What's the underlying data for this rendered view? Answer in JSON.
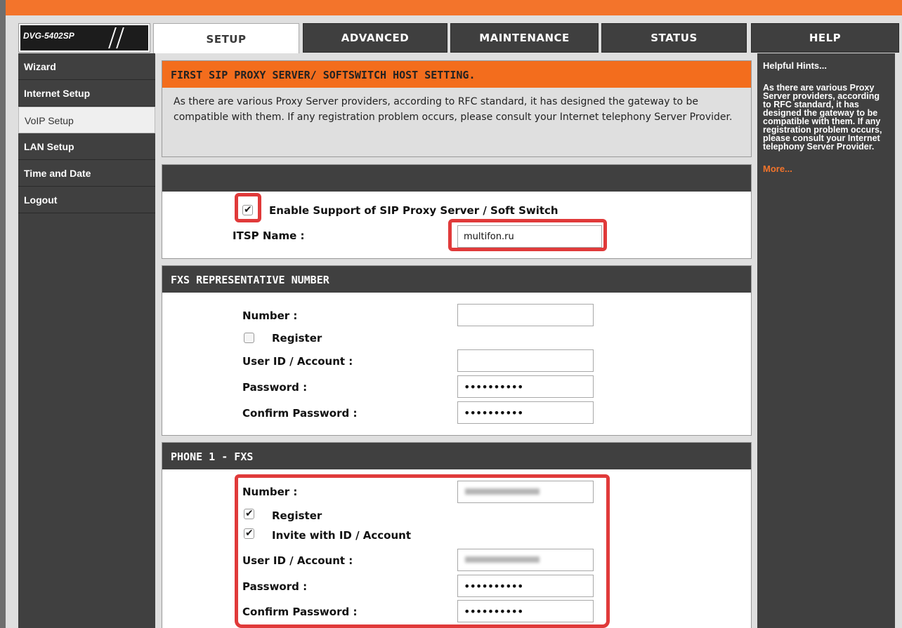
{
  "logo": {
    "text": "DVG-5402SP"
  },
  "tabs": [
    {
      "label": "SETUP"
    },
    {
      "label": "ADVANCED"
    },
    {
      "label": "MAINTENANCE"
    },
    {
      "label": "STATUS"
    },
    {
      "label": "HELP"
    }
  ],
  "nav": [
    {
      "label": "Wizard"
    },
    {
      "label": "Internet Setup"
    },
    {
      "label": "VoIP Setup"
    },
    {
      "label": "LAN Setup"
    },
    {
      "label": "Time and Date"
    },
    {
      "label": "Logout"
    }
  ],
  "help": {
    "title": "Helpful Hints...",
    "body": "As there are various Proxy Server providers, according to RFC standard, it has designed the gateway to be compatible with them. If any registration problem occurs, please consult your Internet telephony Server Provider.",
    "more": "More..."
  },
  "intro": {
    "heading": "FIRST SIP PROXY SERVER/ SOFTSWITCH HOST SETTING.",
    "body": "As there are various Proxy Server providers, according to RFC standard, it has designed the gateway to be compatible with them. If any registration problem occurs, please consult your Internet telephony Server Provider."
  },
  "proxy": {
    "enable_label": "Enable Support of SIP Proxy Server / Soft Switch",
    "enable_checked": true,
    "itsp_label": "ITSP Name :",
    "itsp_value": "multifon.ru"
  },
  "fxs_rep": {
    "heading": "FXS REPRESENTATIVE NUMBER",
    "number_label": "Number :",
    "number_value": "",
    "register_label": "Register",
    "register_checked": false,
    "userid_label": "User ID / Account :",
    "userid_value": "",
    "password_label": "Password :",
    "password_value": "••••••••••",
    "confirm_label": "Confirm Password :",
    "confirm_value": "••••••••••"
  },
  "phone1": {
    "heading": "PHONE 1 - FXS",
    "number_label": "Number :",
    "register_label": "Register",
    "register_checked": true,
    "invite_label": "Invite with ID / Account",
    "invite_checked": true,
    "userid_label": "User ID / Account :",
    "password_label": "Password :",
    "password_value": "••••••••••",
    "confirm_label": "Confirm Password :",
    "confirm_value": "••••••••••"
  },
  "colors": {
    "accent_orange": "#f36d1d",
    "dark_gray": "#404040",
    "highlight_red": "#e03a3a"
  }
}
